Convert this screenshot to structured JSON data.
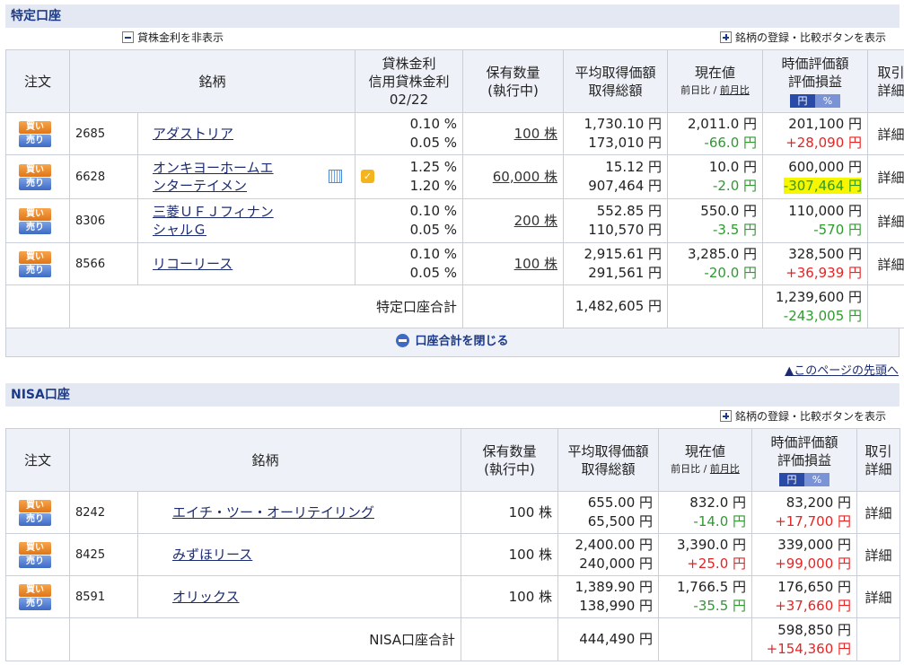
{
  "tokutei": {
    "section_title": "特定口座",
    "toggle_rate_label": "貸株金利を非表示",
    "register_label": "銘柄の登録・比較ボタンを表示",
    "headers": {
      "order": "注文",
      "name": "銘柄",
      "rate1": "貸株金利",
      "rate2": "信用貸株金利",
      "rate3": "02/22",
      "qty1": "保有数量",
      "qty2": "(執行中)",
      "avg1": "平均取得価額",
      "avg2": "取得総額",
      "cur1": "現在値",
      "cur2a": "前日比",
      "cur2sep": " / ",
      "cur2b": "前月比",
      "val1": "時価評価額",
      "val2": "評価損益",
      "yen": "円",
      "pct": "%",
      "trade1": "取引",
      "trade2": "詳細"
    },
    "rows": [
      {
        "code": "2685",
        "name1": "アダストリア",
        "name2": "",
        "rate1": "0.10 %",
        "rate2": "0.05 %",
        "qty": "100 株",
        "avg": "1,730.10 円",
        "total": "173,010 円",
        "price": "2,011.0 円",
        "change": "-66.0 円",
        "value": "201,100 円",
        "pl": "+28,090 円",
        "detail": "詳細"
      },
      {
        "code": "6628",
        "name1": "オンキヨーホームエ",
        "name2": "ンターテイメン",
        "rate1": "1.25 %",
        "rate2": "1.20 %",
        "qty": "60,000 株",
        "avg": "15.12 円",
        "total": "907,464 円",
        "price": "10.0 円",
        "change": "-2.0 円",
        "value": "600,000 円",
        "pl": "-307,464 円",
        "detail": "詳細"
      },
      {
        "code": "8306",
        "name1": "三菱ＵＦＪフィナン",
        "name2": "シャルＧ",
        "rate1": "0.10 %",
        "rate2": "0.05 %",
        "qty": "200 株",
        "avg": "552.85 円",
        "total": "110,570 円",
        "price": "550.0 円",
        "change": "-3.5 円",
        "value": "110,000 円",
        "pl": "-570 円",
        "detail": "詳細"
      },
      {
        "code": "8566",
        "name1": "リコーリース",
        "name2": "",
        "rate1": "0.10 %",
        "rate2": "0.05 %",
        "qty": "100 株",
        "avg": "2,915.61 円",
        "total": "291,561 円",
        "price": "3,285.0 円",
        "change": "-20.0 円",
        "value": "328,500 円",
        "pl": "+36,939 円",
        "detail": "詳細"
      }
    ],
    "total_label": "特定口座合計",
    "total_cost": "1,482,605 円",
    "total_value": "1,239,600 円",
    "total_pl": "-243,005 円",
    "close_label": "口座合計を閉じる",
    "pagetop": "▲このページの先頭へ"
  },
  "nisa": {
    "section_title": "NISA口座",
    "register_label": "銘柄の登録・比較ボタンを表示",
    "rows": [
      {
        "code": "8242",
        "name1": "エイチ・ツー・オーリテイリング",
        "qty": "100 株",
        "avg": "655.00 円",
        "total": "65,500 円",
        "price": "832.0 円",
        "change": "-14.0 円",
        "value": "83,200 円",
        "pl": "+17,700 円",
        "detail": "詳細"
      },
      {
        "code": "8425",
        "name1": "みずほリース",
        "qty": "100 株",
        "avg": "2,400.00 円",
        "total": "240,000 円",
        "price": "3,390.0 円",
        "change": "+25.0 円",
        "value": "339,000 円",
        "pl": "+99,000 円",
        "detail": "詳細"
      },
      {
        "code": "8591",
        "name1": "オリックス",
        "qty": "100 株",
        "avg": "1,389.90 円",
        "total": "138,990 円",
        "price": "1,766.5 円",
        "change": "-35.5 円",
        "value": "176,650 円",
        "pl": "+37,660 円",
        "detail": "詳細"
      }
    ],
    "total_label": "NISA口座合計",
    "total_cost": "444,490 円",
    "total_value": "598,850 円",
    "total_pl": "+154,360 円"
  },
  "order_buttons": {
    "buy": "買い",
    "sell": "売り"
  },
  "colors": {
    "positive": "#e52424",
    "negative": "#2e9a2e",
    "highlight": "#f6f600",
    "header_bg": "#eef1f8",
    "section_bg": "#e4e8f3"
  }
}
